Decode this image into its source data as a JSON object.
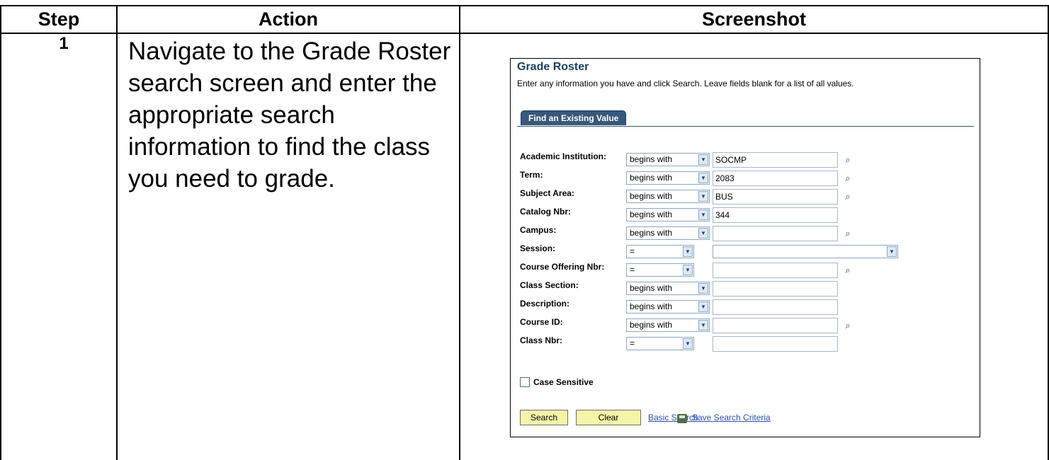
{
  "table": {
    "headers": {
      "step": "Step",
      "action": "Action",
      "screenshot": "Screenshot"
    },
    "rows": [
      {
        "step": "1",
        "action": "Navigate to the Grade Roster search screen and enter the appropriate search information to find the class you need to grade."
      }
    ]
  },
  "panel": {
    "title": "Grade Roster",
    "instructions": "Enter any information you have and click Search. Leave fields blank for a list of all values.",
    "tab": "Find an Existing Value",
    "fields": [
      {
        "label": "Academic Institution:",
        "operator": "begins with",
        "value": "SOCMP",
        "lookup": true
      },
      {
        "label": "Term:",
        "operator": "begins with",
        "value": "2083",
        "lookup": true
      },
      {
        "label": "Subject Area:",
        "operator": "begins with",
        "value": "BUS",
        "lookup": true
      },
      {
        "label": "Catalog Nbr:",
        "operator": "begins with",
        "value": "344",
        "lookup": false
      },
      {
        "label": "Campus:",
        "operator": "begins with",
        "value": "",
        "lookup": true
      },
      {
        "label": "Session:",
        "operator": "=",
        "value": "",
        "lookup": false,
        "value_is_dropdown": true
      },
      {
        "label": "Course Offering Nbr:",
        "operator": "=",
        "value": "",
        "lookup": true
      },
      {
        "label": "Class Section:",
        "operator": "begins with",
        "value": "",
        "lookup": false
      },
      {
        "label": "Description:",
        "operator": "begins with",
        "value": "",
        "lookup": false
      },
      {
        "label": "Course ID:",
        "operator": "begins with",
        "value": "",
        "lookup": true
      },
      {
        "label": "Class Nbr:",
        "operator": "=",
        "value": "",
        "lookup": false
      }
    ],
    "case_sensitive_label": "Case Sensitive",
    "case_sensitive_checked": false,
    "buttons": {
      "search": "Search",
      "clear": "Clear"
    },
    "links": {
      "basic_search": "Basic Search",
      "save_criteria": "Save Search Criteria"
    },
    "icons": {
      "lookup": "magnifier-icon",
      "dropdown": "chevron-down-icon",
      "save": "save-disk-icon"
    }
  }
}
